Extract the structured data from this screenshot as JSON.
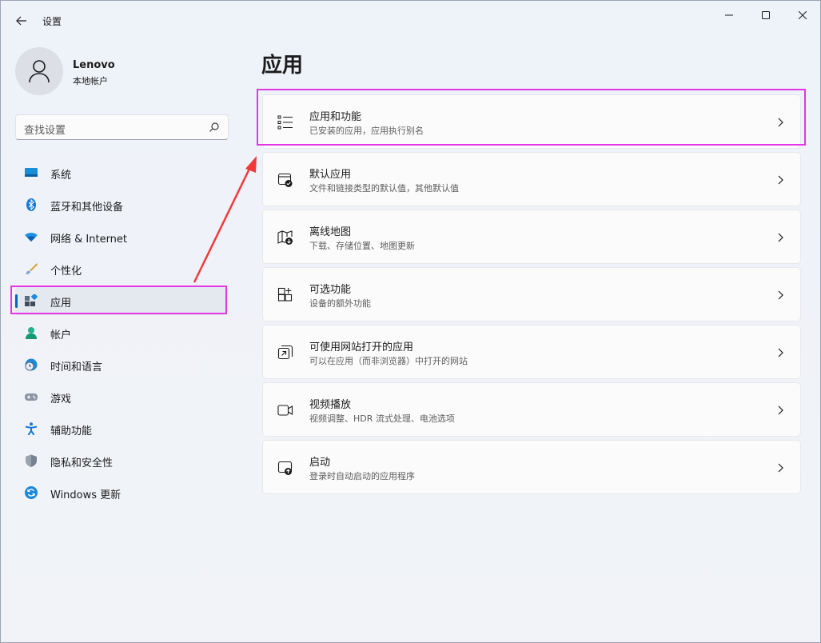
{
  "app": {
    "title": "设置"
  },
  "user": {
    "name": "Lenovo",
    "account_type": "本地帐户"
  },
  "search": {
    "placeholder": "查找设置"
  },
  "sidebar": {
    "items": [
      {
        "label": "系统",
        "icon": "monitor-icon"
      },
      {
        "label": "蓝牙和其他设备",
        "icon": "bluetooth-icon"
      },
      {
        "label": "网络 & Internet",
        "icon": "wifi-icon"
      },
      {
        "label": "个性化",
        "icon": "brush-icon"
      },
      {
        "label": "应用",
        "icon": "apps-icon",
        "active": true
      },
      {
        "label": "帐户",
        "icon": "person-icon"
      },
      {
        "label": "时间和语言",
        "icon": "clock-globe-icon"
      },
      {
        "label": "游戏",
        "icon": "gamepad-icon"
      },
      {
        "label": "辅助功能",
        "icon": "accessibility-icon"
      },
      {
        "label": "隐私和安全性",
        "icon": "shield-icon"
      },
      {
        "label": "Windows 更新",
        "icon": "update-icon"
      }
    ]
  },
  "main": {
    "title": "应用",
    "cards": [
      {
        "title": "应用和功能",
        "subtitle": "已安装的应用，应用执行别名",
        "icon": "list-icon"
      },
      {
        "title": "默认应用",
        "subtitle": "文件和链接类型的默认值，其他默认值",
        "icon": "default-app-icon"
      },
      {
        "title": "离线地图",
        "subtitle": "下载、存储位置、地图更新",
        "icon": "map-download-icon"
      },
      {
        "title": "可选功能",
        "subtitle": "设备的额外功能",
        "icon": "add-grid-icon"
      },
      {
        "title": "可使用网站打开的应用",
        "subtitle": "可以在应用（而非浏览器）中打开的网站",
        "icon": "open-external-icon"
      },
      {
        "title": "视频播放",
        "subtitle": "视频调整、HDR 流式处理、电池选项",
        "icon": "video-icon"
      },
      {
        "title": "启动",
        "subtitle": "登录时自动启动的应用程序",
        "icon": "startup-icon"
      }
    ]
  },
  "colors": {
    "accent": "#0067c0",
    "highlight": "#e536e5",
    "arrow": "#f03a3a"
  }
}
